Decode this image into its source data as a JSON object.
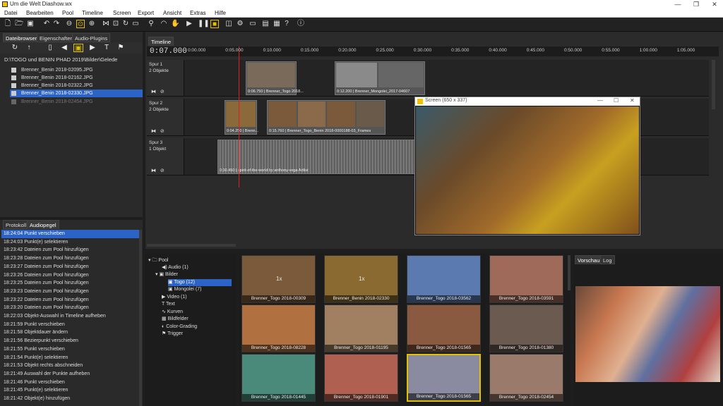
{
  "window": {
    "title": "Um die Welt Diashow.wx",
    "buttons": [
      "—",
      "❐",
      "✕"
    ]
  },
  "menu": [
    "Datei",
    "Bearbeiten",
    "Pool",
    "Timeline",
    "Screen",
    "Export",
    "Ansicht",
    "Extras",
    "Hilfe"
  ],
  "left_tabs": [
    "Dateibrowser",
    "Eigenschaften",
    "Audio-Plugins"
  ],
  "path": "D:\\TOGO und BENIN PHAD 2019\\Bilder\\Gelede",
  "files": [
    {
      "name": "Brenner_Benin 2018-02095.JPG",
      "state": "normal"
    },
    {
      "name": "Brenner_Benin 2018-02162.JPG",
      "state": "normal"
    },
    {
      "name": "Brenner_Benin 2018-02322.JPG",
      "state": "normal"
    },
    {
      "name": "Brenner_Benin 2018-02330.JPG",
      "state": "selected"
    },
    {
      "name": "Brenner_Benin 2018-02454.JPG",
      "state": "dim"
    }
  ],
  "log_tabs": [
    "Protokoll",
    "Audiopegel"
  ],
  "log": [
    {
      "time": "18:24:04",
      "text": "Punkt verschieben"
    },
    {
      "time": "18:24:03",
      "text": "Punkt(e) selektieren"
    },
    {
      "time": "18:23:42",
      "text": "Dateien zum Pool hinzufügen"
    },
    {
      "time": "18:23:28",
      "text": "Dateien zum Pool hinzufügen"
    },
    {
      "time": "18:23:27",
      "text": "Dateien zum Pool hinzufügen"
    },
    {
      "time": "18:23:26",
      "text": "Dateien zum Pool hinzufügen"
    },
    {
      "time": "18:23:25",
      "text": "Dateien zum Pool hinzufügen"
    },
    {
      "time": "18:23:23",
      "text": "Dateien zum Pool hinzufügen"
    },
    {
      "time": "18:23:22",
      "text": "Dateien zum Pool hinzufügen"
    },
    {
      "time": "18:23:20",
      "text": "Dateien zum Pool hinzufügen"
    },
    {
      "time": "18:22:03",
      "text": "Objekt-Auswahl in Timeline aufheben"
    },
    {
      "time": "18:21:59",
      "text": "Punkt verschieben"
    },
    {
      "time": "18:21:58",
      "text": "Objektdauer ändern"
    },
    {
      "time": "18:21:56",
      "text": "Bezierpunkt verschieben"
    },
    {
      "time": "18:21:55",
      "text": "Punkt verschieben"
    },
    {
      "time": "18:21:54",
      "text": "Punkt(e) selektieren"
    },
    {
      "time": "18:21:53",
      "text": "Objekt rechts abschneiden"
    },
    {
      "time": "18:21:49",
      "text": "Auswahl der Punkte aufheben"
    },
    {
      "time": "18:21:46",
      "text": "Punkt verschieben"
    },
    {
      "time": "18:21:45",
      "text": "Punkt(e) selektieren"
    },
    {
      "time": "18:21:42",
      "text": "Objekt(e) hinzufügen"
    }
  ],
  "timeline": {
    "tab": "Timeline",
    "timecode": "0:07.000",
    "ticks": [
      "0:00.000",
      "0:05.000",
      "0:10.000",
      "0:15.000",
      "0:20.000",
      "0:25.000",
      "0:30.000",
      "0:35.000",
      "0:40.000",
      "0:45.000",
      "0:50.000",
      "0:55.000",
      "1:00.000",
      "1:05.000"
    ],
    "tracks": [
      {
        "name": "Spur 1",
        "count": "2 Objekte"
      },
      {
        "name": "Spur 2",
        "count": "2 Objekte"
      },
      {
        "name": "Spur 3",
        "count": "1 Objekt"
      }
    ],
    "clips": {
      "c1": "0:06.750 | Brenner_Togo 2018...",
      "c2": "0:12.200 | Brenner_Mongolei_2017-04607",
      "c3": "0:04.250 | Brenn...",
      "c4": "0:15.760 | Brenner_Togo_Benin 2018-0000188-03_Frames",
      "c5": "0:30.450 | spirit-of-the-world by anthony-vega Artlist"
    }
  },
  "screen_window": {
    "title": "Screen (650 x 337)"
  },
  "pool": {
    "root": "Pool",
    "items": [
      {
        "label": "Audio (1)"
      },
      {
        "label": "Bilder"
      },
      {
        "label": "Togo (12)"
      },
      {
        "label": "Mongolei (7)"
      },
      {
        "label": "Video (1)"
      },
      {
        "label": "Text"
      },
      {
        "label": "Kurven"
      },
      {
        "label": "Bildfelder"
      },
      {
        "label": "Color-Grading"
      },
      {
        "label": "Trigger"
      }
    ]
  },
  "thumbnails": [
    {
      "caption": "Brenner_Togo 2018-00309",
      "mark": "1x",
      "color": "#7a5a3a"
    },
    {
      "caption": "Brenner_Benin 2018-02330",
      "mark": "1x",
      "color": "#8a6a30"
    },
    {
      "caption": "Brenner_Togo 2018-03562",
      "mark": "",
      "color": "#5a7ab0"
    },
    {
      "caption": "Brenner_Togo 2018-03591",
      "mark": "",
      "color": "#a06a5a"
    },
    {
      "caption": "Brenner_Togo 2018-08228",
      "mark": "",
      "color": "#b07040"
    },
    {
      "caption": "Brenner_Togo 2018-01195",
      "mark": "",
      "color": "#a08060"
    },
    {
      "caption": "Brenner_Togo 2018-01565",
      "mark": "",
      "color": "#8a5a40"
    },
    {
      "caption": "Brenner_Togo 2018-01380",
      "mark": "",
      "color": "#6a5a50"
    },
    {
      "caption": "Brenner_Togo 2018-01445",
      "mark": "",
      "color": "#4a8a7a"
    },
    {
      "caption": "Brenner_Togo 2018-01901",
      "mark": "",
      "color": "#b06050"
    },
    {
      "caption": "Brenner_Togo 2018-01565",
      "mark": "",
      "color": "#8a8aa0"
    },
    {
      "caption": "Brenner_Togo 2018-02454",
      "mark": "",
      "color": "#9a7a6a"
    }
  ],
  "right_tabs": [
    "Vorschau",
    "Log"
  ],
  "colors": {
    "selection": "#2b63c6",
    "highlight": "#e0c000",
    "playhead": "#e02020"
  }
}
